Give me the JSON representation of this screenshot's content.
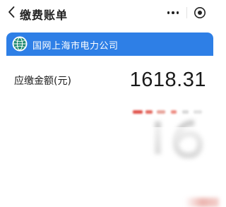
{
  "nav": {
    "title": "缴费账单",
    "back_icon": "chevron-left-icon",
    "more_icon": "ellipsis-icon",
    "close_icon": "target-circle-icon"
  },
  "card": {
    "company_name": "国网上海市电力公司",
    "logo_icon": "state-grid-globe-icon",
    "amount_label": "应缴金额(元)",
    "amount_value": "1618.31"
  },
  "colors": {
    "header_blue": "#2e7fe6",
    "logo_green": "#1f8a70",
    "text_dark": "#1a1a1a",
    "redact_red": "#e0524a"
  }
}
